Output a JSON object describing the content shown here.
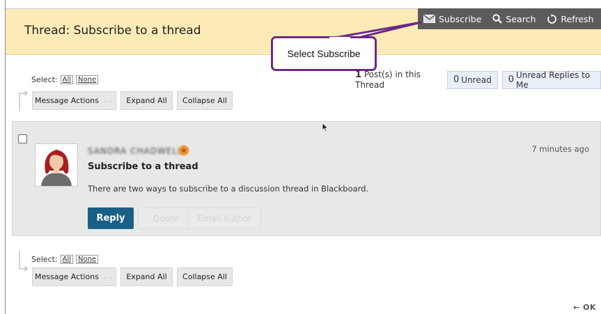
{
  "header": {
    "title": "Thread: Subscribe to a thread",
    "tools": {
      "subscribe": "Subscribe",
      "search": "Search",
      "refresh": "Refresh"
    }
  },
  "callout": {
    "text": "Select Subscribe"
  },
  "top_toolbar": {
    "select_label": "Select:",
    "all": "All",
    "none": "None",
    "message_actions": "Message Actions",
    "expand_all": "Expand All",
    "collapse_all": "Collapse All"
  },
  "counts": {
    "posts_number": "1",
    "posts_label": "Post(s) in this Thread",
    "unread_number": "0",
    "unread_label": "Unread",
    "unread_replies_number": "0",
    "unread_replies_label": "Unread Replies to Me"
  },
  "post": {
    "author": "SANDRA CHADWELL",
    "title": "Subscribe to a thread",
    "time": "7 minutes ago",
    "body": "There are two ways to subscribe to a discussion thread in Blackboard.",
    "reply": "Reply",
    "quote": "Quote",
    "email_author": "Email Author"
  },
  "bottom_toolbar": {
    "select_label": "Select:",
    "all": "All",
    "none": "None",
    "message_actions": "Message Actions",
    "expand_all": "Expand All",
    "collapse_all": "Collapse All"
  },
  "footer": {
    "ok": "← OK"
  },
  "colors": {
    "header_bg": "#fcebb6",
    "toolbar_bg": "#5b5b5b",
    "callout_border": "#6e2a83",
    "reply_bg": "#1a5f86"
  }
}
